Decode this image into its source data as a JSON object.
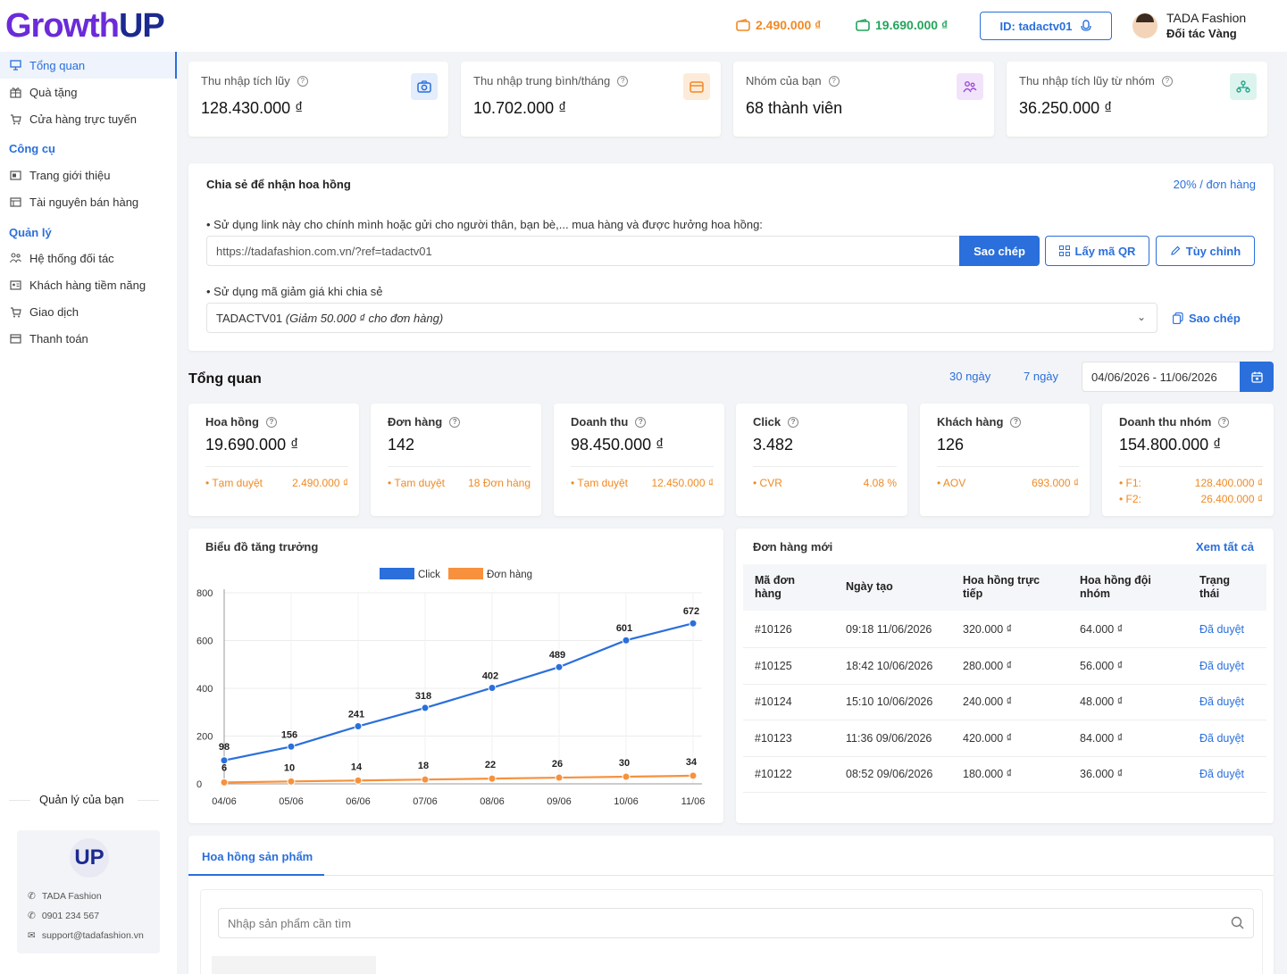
{
  "header": {
    "logo_part1": "Growth",
    "logo_part2": "UP",
    "pending_amount": "2.490.000 ₫",
    "balance_amount": "19.690.000 ₫",
    "id_label": "ID: tadactv01",
    "user_name": "TADA Fashion",
    "user_role": "Đối tác Vàng"
  },
  "sidebar": {
    "items_main": [
      {
        "label": "Tổng quan",
        "icon": "monitor-icon"
      },
      {
        "label": "Quà tặng",
        "icon": "gift-icon"
      },
      {
        "label": "Cửa hàng trực tuyến",
        "icon": "cart-icon"
      }
    ],
    "section_tools": "Công cụ",
    "items_tools": [
      {
        "label": "Trang giới thiệu",
        "icon": "page-icon"
      },
      {
        "label": "Tài nguyên bán hàng",
        "icon": "resource-icon"
      }
    ],
    "section_manage": "Quản lý",
    "items_manage": [
      {
        "label": "Hệ thống đối tác",
        "icon": "network-icon"
      },
      {
        "label": "Khách hàng tiềm năng",
        "icon": "id-card-icon"
      },
      {
        "label": "Giao dịch",
        "icon": "cart-icon"
      },
      {
        "label": "Thanh toán",
        "icon": "card-icon"
      }
    ],
    "manager_title": "Quản lý của bạn",
    "manager_logo": "UP",
    "manager_name": "TADA Fashion",
    "manager_phone": "0901 234 567",
    "manager_email": "support@tadafashion.vn"
  },
  "kpis": [
    {
      "title": "Thu nhập tích lũy",
      "value": "128.430.000 ₫",
      "icon": "camera-icon",
      "color": "#2a6fdb",
      "bg": "#e3edfb"
    },
    {
      "title": "Thu nhập trung bình/tháng",
      "value": "10.702.000 ₫",
      "icon": "wallet-icon",
      "color": "#f08a24",
      "bg": "#fdebd9"
    },
    {
      "title": "Nhóm của bạn",
      "value": "68 thành viên",
      "icon": "group-icon",
      "color": "#9b4fd6",
      "bg": "#f1e4fa"
    },
    {
      "title": "Thu nhập tích lũy từ nhóm",
      "value": "36.250.000 ₫",
      "icon": "tree-icon",
      "color": "#22a58a",
      "bg": "#ddf4ee"
    }
  ],
  "share": {
    "title": "Chia sẻ để nhận hoa hồng",
    "rate": "20% / đơn hàng",
    "text1": "• Sử dụng link này cho chính mình hoặc gửi cho người thân, bạn bè,... mua hàng và được hưởng hoa hồng:",
    "link": "https://tadafashion.com.vn/?ref=tadactv01",
    "copy_label": "Sao chép",
    "qr_label": "Lấy mã QR",
    "custom_label": "Tùy chỉnh",
    "text2": "• Sử dụng mã giảm giá khi chia sẻ",
    "coupon_code": "TADACTV01",
    "coupon_desc": "(Giảm 50.000 ₫ cho đơn hàng)",
    "coupon_copy": "Sao chép"
  },
  "overview": {
    "title": "Tổng quan",
    "range30": "30 ngày",
    "range7": "7 ngày",
    "date_range": "04/06/2026 - 11/06/2026"
  },
  "metrics": [
    {
      "title": "Hoa hồng",
      "value": "19.690.000 ₫",
      "sub_label": "• Tạm duyệt",
      "sub_value": "2.490.000 ₫"
    },
    {
      "title": "Đơn hàng",
      "value": "142",
      "sub_label": "• Tạm duyệt",
      "sub_value": "18 Đơn hàng"
    },
    {
      "title": "Doanh thu",
      "value": "98.450.000 ₫",
      "sub_label": "• Tạm duyệt",
      "sub_value": "12.450.000 ₫"
    },
    {
      "title": "Click",
      "value": "3.482",
      "sub_label": "• CVR",
      "sub_value": "4.08 %"
    },
    {
      "title": "Khách hàng",
      "value": "126",
      "sub_label": "• AOV",
      "sub_value": "693.000 ₫"
    },
    {
      "title": "Doanh thu nhóm",
      "value": "154.800.000 ₫",
      "sub_label": "• F1:",
      "sub_value": "128.400.000 ₫",
      "sub_label2": "• F2:",
      "sub_value2": "26.400.000 ₫"
    }
  ],
  "chart_data": {
    "type": "line",
    "title": "Biểu đồ tăng trưởng",
    "categories": [
      "04/06",
      "05/06",
      "06/06",
      "07/06",
      "08/06",
      "09/06",
      "10/06",
      "11/06"
    ],
    "series": [
      {
        "name": "Click",
        "values": [
          98,
          156,
          241,
          318,
          402,
          489,
          601,
          672
        ],
        "color": "#2a6fdb"
      },
      {
        "name": "Đơn hàng",
        "values": [
          6,
          10,
          14,
          18,
          22,
          26,
          30,
          34
        ],
        "color": "#f7913d"
      }
    ],
    "yticks": [
      0,
      200,
      400,
      600,
      800
    ],
    "ylim": [
      0,
      800
    ],
    "grid": true,
    "legend": "top-center"
  },
  "orders": {
    "title": "Đơn hàng mới",
    "view_all": "Xem tất cả",
    "headers": [
      "Mã đơn hàng",
      "Ngày tạo",
      "Hoa hồng trực tiếp",
      "Hoa hồng đội nhóm",
      "Trạng thái"
    ],
    "rows": [
      [
        "#10126",
        "09:18 11/06/2026",
        "320.000 ₫",
        "64.000 ₫",
        "Đã duyệt"
      ],
      [
        "#10125",
        "18:42 10/06/2026",
        "280.000 ₫",
        "56.000 ₫",
        "Đã duyệt"
      ],
      [
        "#10124",
        "15:10 10/06/2026",
        "240.000 ₫",
        "48.000 ₫",
        "Đã duyệt"
      ],
      [
        "#10123",
        "11:36 09/06/2026",
        "420.000 ₫",
        "84.000 ₫",
        "Đã duyệt"
      ],
      [
        "#10122",
        "08:52 09/06/2026",
        "180.000 ₫",
        "36.000 ₫",
        "Đã duyệt"
      ]
    ]
  },
  "product": {
    "tab": "Hoa hồng sản phẩm",
    "search_placeholder": "Nhập sản phẩm cần tìm"
  }
}
